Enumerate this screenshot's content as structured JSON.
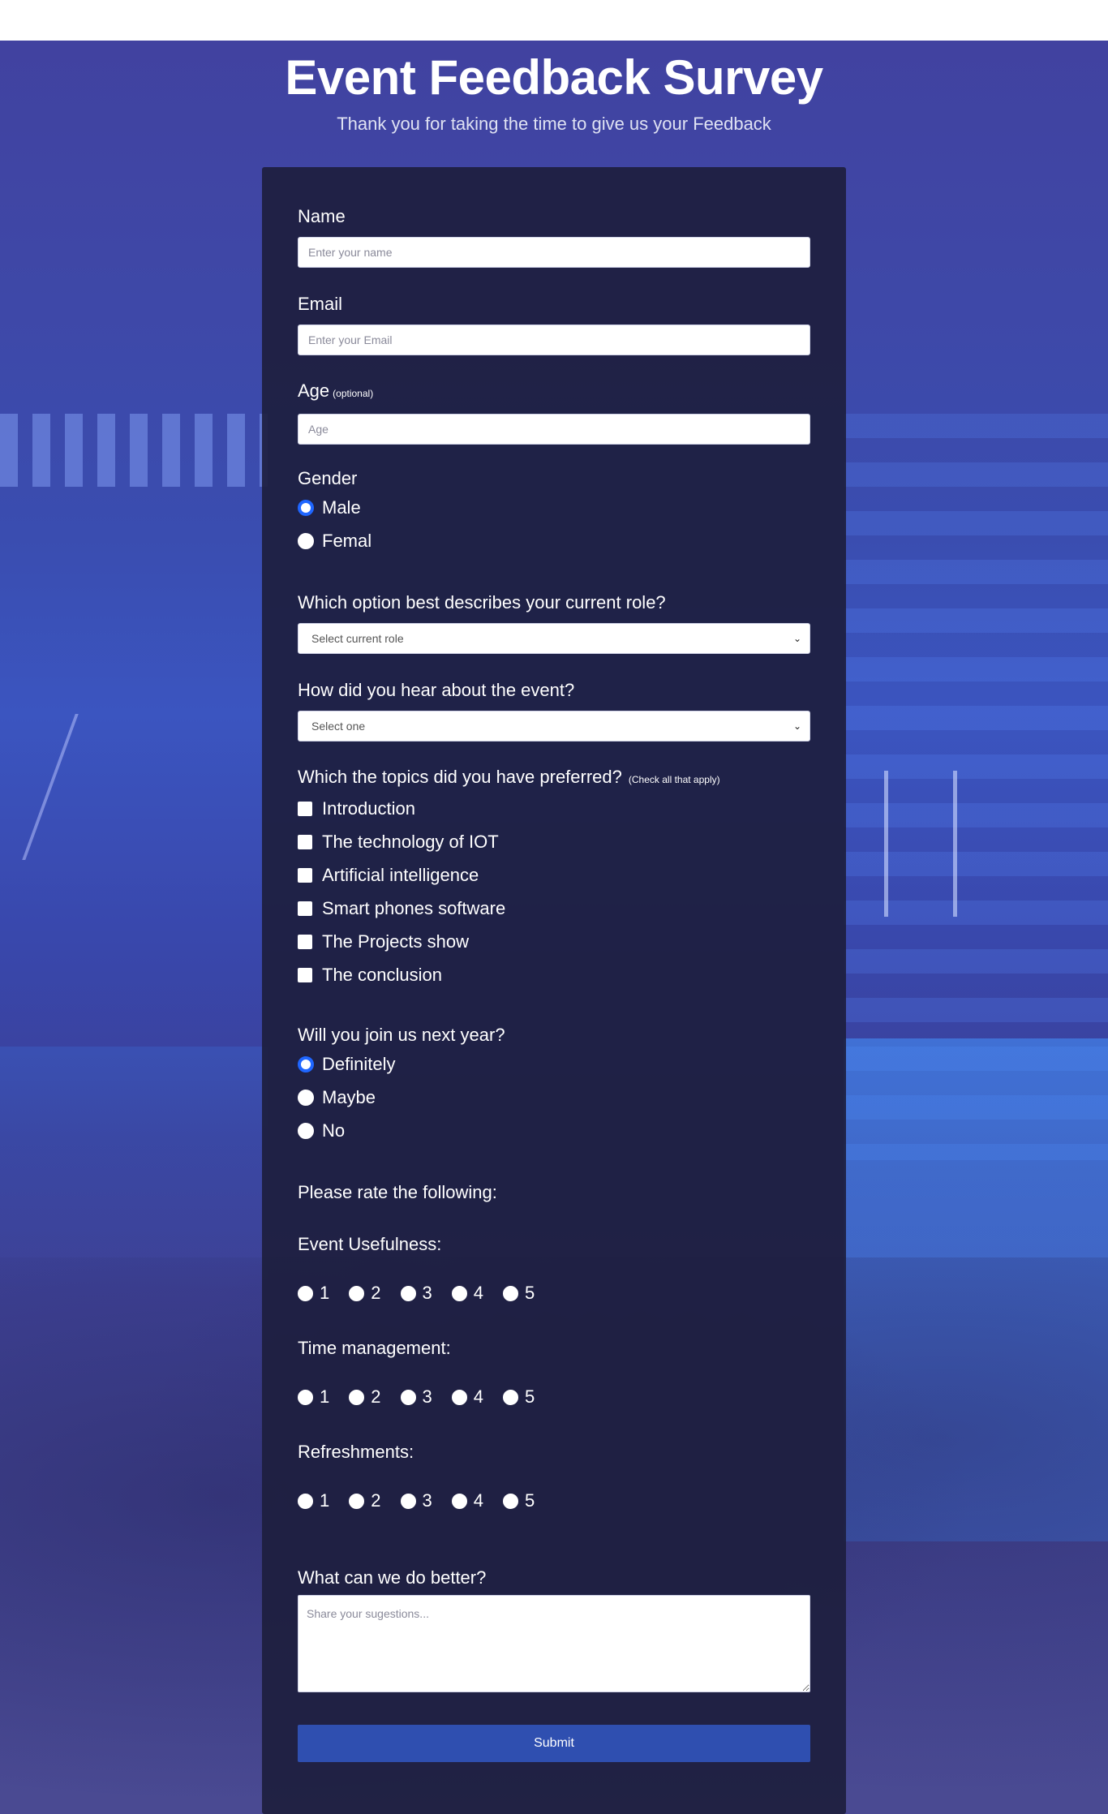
{
  "header": {
    "title": "Event Feedback Survey",
    "subtitle": "Thank you for taking the time to give us your Feedback"
  },
  "form": {
    "name": {
      "label": "Name",
      "placeholder": "Enter your name",
      "value": ""
    },
    "email": {
      "label": "Email",
      "placeholder": "Enter your Email",
      "value": ""
    },
    "age": {
      "label": "Age",
      "hint": "(optional)",
      "placeholder": "Age",
      "value": ""
    },
    "gender": {
      "label": "Gender",
      "options": [
        {
          "label": "Male",
          "checked": true
        },
        {
          "label": "Femal",
          "checked": false
        }
      ]
    },
    "role": {
      "label": "Which option best describes your current role?",
      "selected": "Select current role"
    },
    "heard": {
      "label": "How did you hear about the event?",
      "selected": "Select one"
    },
    "topics": {
      "label": "Which the topics did you have preferred?",
      "hint": "(Check all that apply)",
      "options": [
        "Introduction",
        "The technology of IOT",
        "Artificial intelligence",
        "Smart phones software",
        "The Projects show",
        "The conclusion"
      ]
    },
    "join": {
      "label": "Will you join us next year?",
      "options": [
        {
          "label": "Definitely",
          "checked": true
        },
        {
          "label": "Maybe",
          "checked": false
        },
        {
          "label": "No",
          "checked": false
        }
      ]
    },
    "rate_heading": "Please rate the following:",
    "ratings": [
      {
        "label": "Event Usefulness:",
        "values": [
          "1",
          "2",
          "3",
          "4",
          "5"
        ]
      },
      {
        "label": "Time management:",
        "values": [
          "1",
          "2",
          "3",
          "4",
          "5"
        ]
      },
      {
        "label": "Refreshments:",
        "values": [
          "1",
          "2",
          "3",
          "4",
          "5"
        ]
      }
    ],
    "better": {
      "label": "What can we do better?",
      "placeholder": "Share your sugestions..."
    },
    "submit_label": "Submit"
  },
  "colors": {
    "accent_radio": "#1f66ff",
    "submit_button": "#2f4fb0",
    "card_background": "#1d1e3e"
  }
}
